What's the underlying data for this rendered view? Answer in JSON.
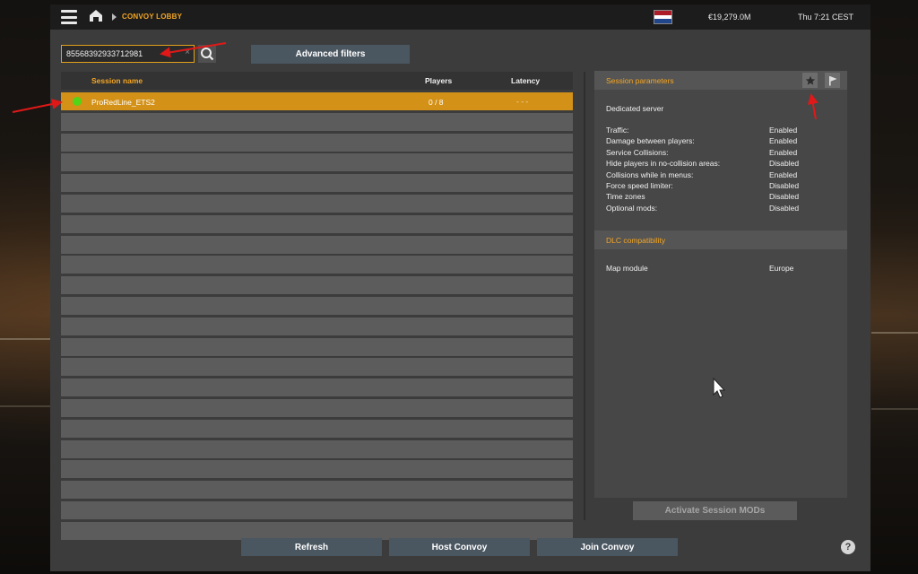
{
  "header": {
    "title": "CONVOY LOBBY",
    "money": "€19,279.0M",
    "time": "Thu 7:21 CEST",
    "flag_colors": [
      "#ae1c28",
      "#ffffff",
      "#21468b"
    ]
  },
  "search": {
    "value": "85568392933712981",
    "clear_glyph": "×"
  },
  "toolbar": {
    "advanced_filters_label": "Advanced filters"
  },
  "sessions": {
    "columns": {
      "name": "Session name",
      "players": "Players",
      "latency": "Latency"
    },
    "rows": [
      {
        "name": "ProRedLine_ETS2",
        "players": "0 / 8",
        "latency": "- - -",
        "status_color": "#52d417"
      }
    ],
    "empty_row_count": 21
  },
  "params": {
    "title": "Session parameters",
    "server_type": "Dedicated server",
    "items": [
      {
        "label": "Traffic:",
        "value": "Enabled"
      },
      {
        "label": "Damage between players:",
        "value": "Enabled"
      },
      {
        "label": "Service Collisions:",
        "value": "Enabled"
      },
      {
        "label": "Hide players in no-collision areas:",
        "value": "Disabled"
      },
      {
        "label": "Collisions while in menus:",
        "value": "Enabled"
      },
      {
        "label": "Force speed limiter:",
        "value": "Disabled"
      },
      {
        "label": "Time zones",
        "value": "Disabled"
      },
      {
        "label": "Optional mods:",
        "value": "Disabled"
      }
    ]
  },
  "dlc": {
    "title": "DLC compatibility",
    "map_module_label": "Map module",
    "map_module_value": "Europe"
  },
  "actions": {
    "activate_mods": "Activate Session MODs",
    "refresh": "Refresh",
    "host": "Host Convoy",
    "join": "Join Convoy",
    "help": "?"
  },
  "colors": {
    "accent": "#f5a623",
    "selected_row": "#d39117",
    "annotation_red": "#e01818"
  }
}
